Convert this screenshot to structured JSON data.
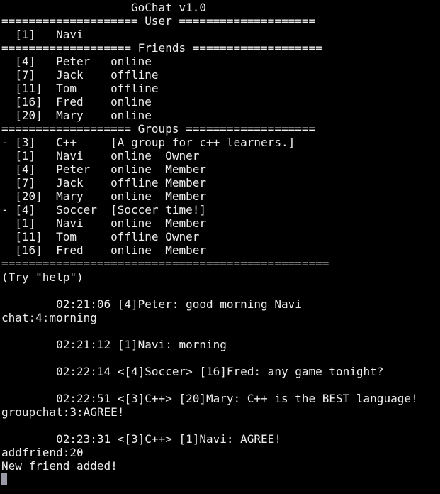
{
  "colors": {
    "background": "#000000",
    "text": "#ededed",
    "cursor": "#9a9aa6"
  },
  "title": "                   GoChat v1.0",
  "sections": {
    "user_header": "==================== User ====================",
    "friends_header": "=================== Friends ===================",
    "groups_header": "=================== Groups ===================",
    "footer_rule": "================================================"
  },
  "user": {
    "row": "  [1]   Navi"
  },
  "friends": [
    "  [4]   Peter   online",
    "  [7]   Jack    offline",
    "  [11]  Tom     offline",
    "  [16]  Fred    online",
    "  [20]  Mary    online"
  ],
  "groups": [
    {
      "row": "- [3]   C++     [A group for c++ learners.]",
      "members": [
        "  [1]   Navi    online  Owner",
        "  [4]   Peter   online  Member",
        "  [7]   Jack    offline Member",
        "  [20]  Mary    online  Member"
      ]
    },
    {
      "row": "- [4]   Soccer  [Soccer time!]",
      "members": [
        "  [1]   Navi    online  Member",
        "  [11]  Tom     offline Owner",
        "  [16]  Fred    online  Member"
      ]
    }
  ],
  "hint": "(Try \"help\")",
  "log": [
    "",
    "        02:21:06 [4]Peter: good morning Navi",
    "chat:4:morning",
    "",
    "        02:21:12 [1]Navi: morning",
    "",
    "        02:22:14 <[4]Soccer> [16]Fred: any game tonight?",
    "",
    "        02:22:51 <[3]C++> [20]Mary: C++ is the BEST language!",
    "groupchat:3:AGREE!",
    "",
    "        02:23:31 <[3]C++> [1]Navi: AGREE!",
    "addfriend:20",
    "New friend added!"
  ]
}
